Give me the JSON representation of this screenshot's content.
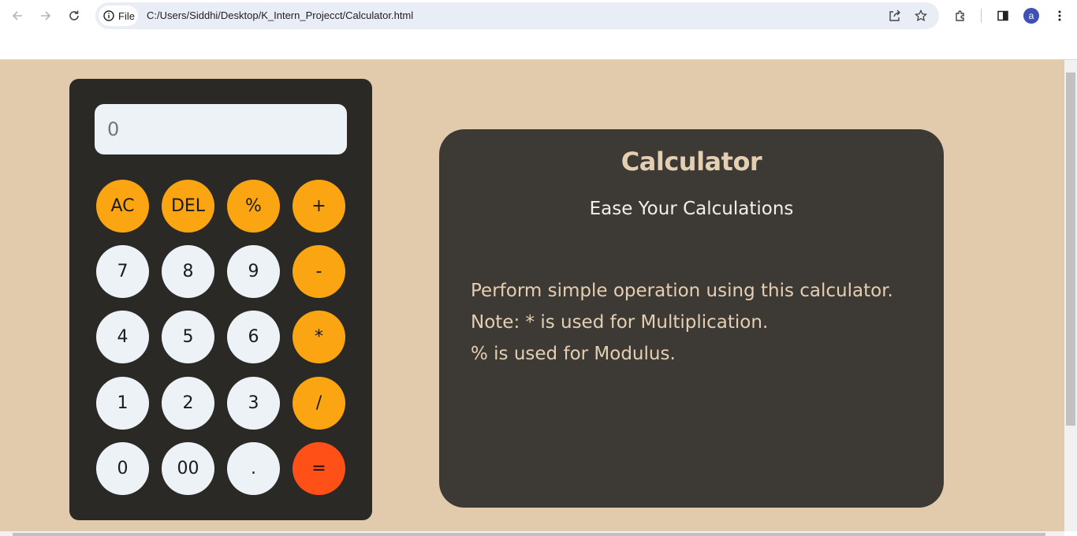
{
  "browser": {
    "chip_label": "File",
    "url": "C:/Users/Siddhi/Desktop/K_Intern_Projecct/Calculator.html",
    "avatar_letter": "a"
  },
  "calculator": {
    "display_placeholder": "0",
    "keys": {
      "ac": "AC",
      "del": "DEL",
      "percent": "%",
      "plus": "+",
      "seven": "7",
      "eight": "8",
      "nine": "9",
      "minus": "-",
      "four": "4",
      "five": "5",
      "six": "6",
      "multiply": "*",
      "one": "1",
      "two": "2",
      "three": "3",
      "divide": "/",
      "zero": "0",
      "double_zero": "00",
      "dot": ".",
      "equals": "="
    }
  },
  "info": {
    "title": "Calculator",
    "subtitle": "Ease Your Calculations",
    "lines": [
      "Perform simple operation using this calculator.",
      "Note: * is used for Multiplication.",
      "% is used for Modulus."
    ]
  },
  "colors": {
    "page_background": "#e2caad",
    "calculator_body": "#2b2926",
    "number_key": "#edf2f6",
    "operator_key": "#fca512",
    "equals_key": "#ff5117",
    "info_panel": "#3d3a35",
    "info_text": "#e5cfb3"
  }
}
